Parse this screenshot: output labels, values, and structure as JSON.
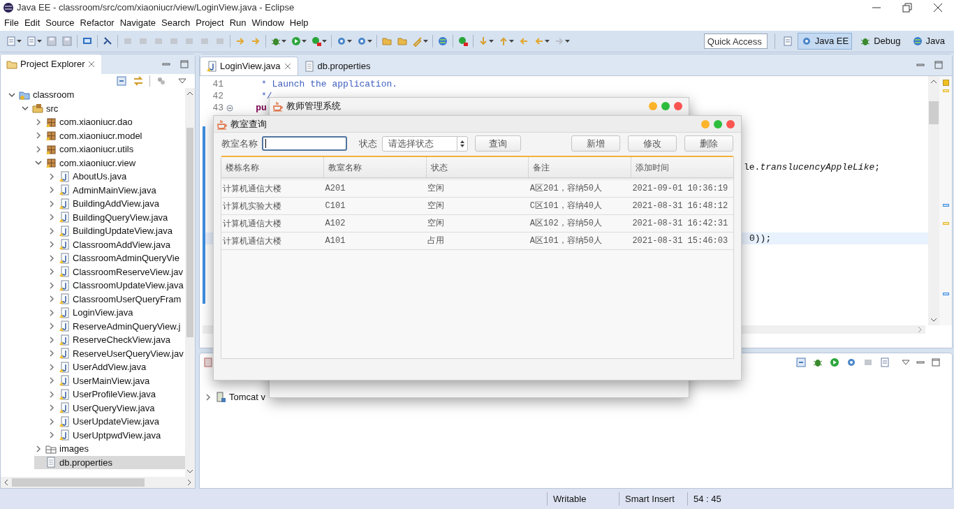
{
  "window": {
    "title": "Java EE - classroom/src/com/xiaoniucr/view/LoginView.java - Eclipse"
  },
  "menu": [
    "File",
    "Edit",
    "Source",
    "Refactor",
    "Navigate",
    "Search",
    "Project",
    "Run",
    "Window",
    "Help"
  ],
  "quick_access": {
    "placeholder": "Quick Access"
  },
  "perspectives": [
    {
      "label": "Java EE",
      "selected": true,
      "kind": "javaee"
    },
    {
      "label": "Debug",
      "selected": false,
      "kind": "debug"
    },
    {
      "label": "Java",
      "selected": false,
      "kind": "java"
    }
  ],
  "project_explorer": {
    "title": "Project Explorer",
    "tree": [
      {
        "label": "classroom",
        "kind": "project",
        "expanded": true,
        "selected": false,
        "children": [
          {
            "label": "src",
            "kind": "source-folder",
            "expanded": true,
            "selected": false,
            "children": [
              {
                "label": "com.xiaoniucr.dao",
                "kind": "package",
                "expanded": false,
                "selected": false
              },
              {
                "label": "com.xiaoniucr.model",
                "kind": "package",
                "expanded": false,
                "selected": false
              },
              {
                "label": "com.xiaoniucr.utils",
                "kind": "package",
                "expanded": false,
                "selected": false
              },
              {
                "label": "com.xiaoniucr.view",
                "kind": "package",
                "expanded": true,
                "selected": false,
                "children": [
                  {
                    "label": "AboutUs.java",
                    "kind": "java-file",
                    "expanded": false,
                    "selected": false
                  },
                  {
                    "label": "AdminMainView.java",
                    "kind": "java-file",
                    "expanded": false,
                    "selected": false
                  },
                  {
                    "label": "BuildingAddView.java",
                    "kind": "java-file",
                    "expanded": false,
                    "selected": false
                  },
                  {
                    "label": "BuildingQueryView.java",
                    "kind": "java-file",
                    "expanded": false,
                    "selected": false
                  },
                  {
                    "label": "BuildingUpdateView.java",
                    "kind": "java-file",
                    "expanded": false,
                    "selected": false
                  },
                  {
                    "label": "ClassroomAddView.java",
                    "kind": "java-file",
                    "expanded": false,
                    "selected": false
                  },
                  {
                    "label": "ClassroomAdminQueryVie",
                    "kind": "java-file",
                    "expanded": false,
                    "selected": false
                  },
                  {
                    "label": "ClassroomReserveView.jav",
                    "kind": "java-file",
                    "expanded": false,
                    "selected": false
                  },
                  {
                    "label": "ClassroomUpdateView.java",
                    "kind": "java-file",
                    "expanded": false,
                    "selected": false
                  },
                  {
                    "label": "ClassroomUserQueryFram",
                    "kind": "java-file",
                    "expanded": false,
                    "selected": false
                  },
                  {
                    "label": "LoginView.java",
                    "kind": "java-file",
                    "expanded": false,
                    "selected": false
                  },
                  {
                    "label": "ReserveAdminQueryView.j",
                    "kind": "java-file",
                    "expanded": false,
                    "selected": false
                  },
                  {
                    "label": "ReserveCheckView.java",
                    "kind": "java-file",
                    "expanded": false,
                    "selected": false
                  },
                  {
                    "label": "ReserveUserQueryView.jav",
                    "kind": "java-file",
                    "expanded": false,
                    "selected": false
                  },
                  {
                    "label": "UserAddView.java",
                    "kind": "java-file",
                    "expanded": false,
                    "selected": false
                  },
                  {
                    "label": "UserMainView.java",
                    "kind": "java-file",
                    "expanded": false,
                    "selected": false
                  },
                  {
                    "label": "UserProfileView.java",
                    "kind": "java-file",
                    "expanded": false,
                    "selected": false
                  },
                  {
                    "label": "UserQueryView.java",
                    "kind": "java-file",
                    "expanded": false,
                    "selected": false
                  },
                  {
                    "label": "UserUpdateView.java",
                    "kind": "java-file",
                    "expanded": false,
                    "selected": false
                  },
                  {
                    "label": "UserUptpwdView.java",
                    "kind": "java-file",
                    "expanded": false,
                    "selected": false
                  }
                ]
              },
              {
                "label": "images",
                "kind": "folder",
                "expanded": false,
                "selected": false
              },
              {
                "label": "db.properties",
                "kind": "file",
                "selected": true
              }
            ]
          }
        ]
      }
    ]
  },
  "editor": {
    "tabs": [
      {
        "label": "LoginView.java",
        "selected": true,
        "kind": "java"
      },
      {
        "label": "db.properties",
        "selected": false,
        "kind": "properties"
      }
    ],
    "lines": [
      {
        "number": "41",
        "text": "     * Launch the application.",
        "kind": "comment"
      },
      {
        "number": "42",
        "text": "     */",
        "kind": "comment"
      },
      {
        "number": "43",
        "text": "    pu",
        "kind": "keyword"
      }
    ],
    "fragments": [
      {
        "text": "le.*translucencyAppleLike*;",
        "current": false
      },
      {
        "text": "0));",
        "current": true
      }
    ]
  },
  "servers": {
    "rows": [
      {
        "label": "Tomcat v",
        "expanded": false
      }
    ]
  },
  "status_bar": [
    "Writable",
    "Smart Insert",
    "54 : 45"
  ],
  "teacher_window": {
    "title": "教师管理系统"
  },
  "classroom_window": {
    "title": "教室查询",
    "name_field": {
      "label": "教室名称",
      "focused": true
    },
    "status_select": {
      "label": "状态",
      "value": "请选择状态"
    },
    "query_button": "查询",
    "action_buttons": [
      "新增",
      "修改",
      "删除"
    ],
    "table": {
      "columns": [
        "楼栋名称",
        "教室名称",
        "状态",
        "备注",
        "添加时间"
      ],
      "rows": [
        [
          "计算机通信大楼",
          "A201",
          "空闲",
          "A区201，容纳50人",
          "2021-09-01 10:36:19"
        ],
        [
          "计算机实验大楼",
          "C101",
          "空闲",
          "C区101，容纳40人",
          "2021-08-31 16:48:12"
        ],
        [
          "计算机通信大楼",
          "A102",
          "空闲",
          "A区102，容纳50人",
          "2021-08-31 16:42:31"
        ],
        [
          "计算机通信大楼",
          "A101",
          "占用",
          "A区101，容纳50人",
          "2021-08-31 15:46:03"
        ]
      ]
    }
  }
}
